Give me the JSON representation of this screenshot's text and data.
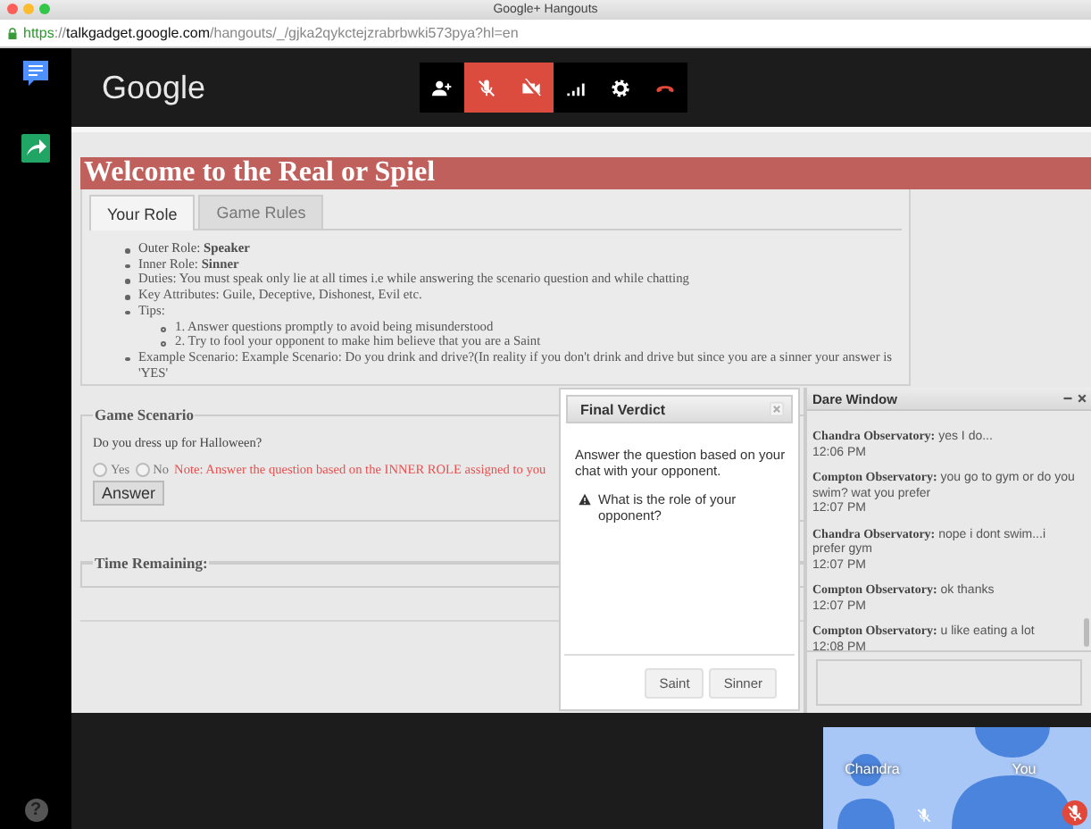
{
  "browser": {
    "title": "Google+ Hangouts",
    "url": {
      "scheme": "https",
      "separator": "://",
      "host": "talkgadget.google.com",
      "path": "/hangouts/_/gjka2qykctejzrabrbwki573pya?hl=en"
    }
  },
  "sidebar": {
    "help": "?"
  },
  "header": {
    "logo": "Google",
    "controls": [
      {
        "kind": "invite",
        "highlighted": false
      },
      {
        "kind": "mic",
        "highlighted": true
      },
      {
        "kind": "camera",
        "highlighted": true
      },
      {
        "kind": "signal",
        "highlighted": false
      },
      {
        "kind": "settings",
        "highlighted": false
      },
      {
        "kind": "hangup",
        "highlighted": false
      }
    ]
  },
  "page": {
    "banner": "Welcome to the Real or Spiel",
    "tabs": [
      {
        "label": "Your Role",
        "selected": true
      },
      {
        "label": "Game Rules",
        "selected": false
      }
    ],
    "role_items": [
      {
        "kind": "bold",
        "text": "Outer Role: **Speaker**"
      },
      {
        "kind": "alert",
        "text": "Inner Role: **Sinner**"
      },
      {
        "kind": "plain",
        "text": "Duties: You must speak only lie at all times i.e while answering the scenario question and while chatting"
      },
      {
        "kind": "plain",
        "text": "Key Attributes: Guile, Deceptive, Dishonest, Evil etc."
      },
      {
        "kind": "plain",
        "text": "Tips:",
        "children": [
          "1. Answer questions promptly to avoid being misunderstood",
          "2. Try to fool your opponent to make him believe that you are a Saint"
        ]
      },
      {
        "kind": "plain",
        "text": "Example Scenario: Example Scenario: Do you drink and drive?(In reality if you don't drink and drive but since you are a sinner your answer is 'YES'"
      }
    ],
    "scenario": {
      "legend": "Game Scenario",
      "question": "Do you dress up for Halloween?",
      "options": [
        {
          "label": "Yes",
          "selected": false
        },
        {
          "label": "No",
          "selected": false
        }
      ],
      "note": "Note: Answer the question based on the INNER ROLE assigned to you",
      "button": "Answer"
    },
    "timer": {
      "legend": "Time Remaining:"
    }
  },
  "dialog": {
    "title": "Final Verdict",
    "message": "Answer the question based on your chat with your opponent.",
    "question": "What is the role of your opponent?",
    "buttons": [
      "Saint",
      "Sinner"
    ]
  },
  "chat": {
    "title": "Dare Window",
    "messages": [
      {
        "sender": "Chandra Observatory:",
        "text": "yes I do...",
        "time": "12:06 PM"
      },
      {
        "sender": "Compton Observatory:",
        "text": "you go to gym or do you swim? wat you prefer",
        "time": "12:07 PM"
      },
      {
        "sender": "Chandra Observatory:",
        "text": "nope i dont swim...i prefer gym",
        "time": "12:07 PM"
      },
      {
        "sender": "Compton Observatory:",
        "text": "ok thanks",
        "time": "12:07 PM"
      },
      {
        "sender": "Compton Observatory:",
        "text": "u like eating a lot",
        "time": "12:08 PM"
      }
    ]
  },
  "video": {
    "participants": [
      {
        "kind": "remote",
        "name": "Chandra",
        "muted": true
      },
      {
        "kind": "self",
        "name": "You",
        "muted": true
      }
    ]
  }
}
